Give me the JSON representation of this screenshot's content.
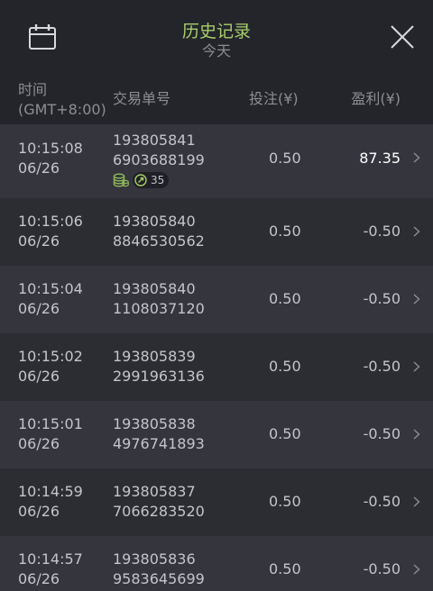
{
  "header": {
    "title": "历史记录",
    "subtitle": "今天"
  },
  "columns": {
    "time_line1": "时间",
    "time_line2": "(GMT+8:00)",
    "order_id": "交易单号",
    "bet": "投注(¥)",
    "profit": "盈利(¥)"
  },
  "colors": {
    "title_accent": "#a6cf6a",
    "row_odd": "#35363d",
    "row_even": "#2c2d33",
    "header_bg": "#24252b"
  },
  "rows": [
    {
      "time": "10:15:08",
      "date": "06/26",
      "id_line1": "193805841",
      "id_line2": "6903688199",
      "bet": "0.50",
      "profit": "87.35",
      "badge_count": "35"
    },
    {
      "time": "10:15:06",
      "date": "06/26",
      "id_line1": "193805840",
      "id_line2": "8846530562",
      "bet": "0.50",
      "profit": "-0.50"
    },
    {
      "time": "10:15:04",
      "date": "06/26",
      "id_line1": "193805840",
      "id_line2": "1108037120",
      "bet": "0.50",
      "profit": "-0.50"
    },
    {
      "time": "10:15:02",
      "date": "06/26",
      "id_line1": "193805839",
      "id_line2": "2991963136",
      "bet": "0.50",
      "profit": "-0.50"
    },
    {
      "time": "10:15:01",
      "date": "06/26",
      "id_line1": "193805838",
      "id_line2": "4976741893",
      "bet": "0.50",
      "profit": "-0.50"
    },
    {
      "time": "10:14:59",
      "date": "06/26",
      "id_line1": "193805837",
      "id_line2": "7066283520",
      "bet": "0.50",
      "profit": "-0.50"
    },
    {
      "time": "10:14:57",
      "date": "06/26",
      "id_line1": "193805836",
      "id_line2": "9583645699",
      "bet": "0.50",
      "profit": "-0.50"
    }
  ]
}
